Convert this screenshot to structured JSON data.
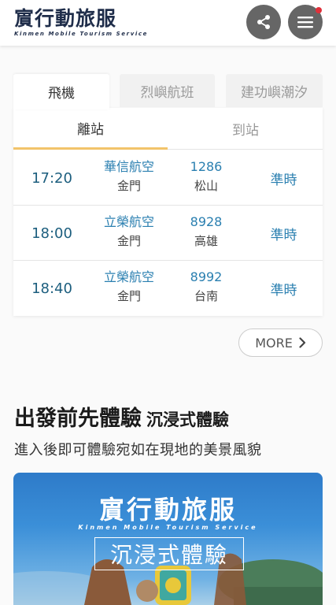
{
  "header": {
    "logo_text": "賔行動旅服",
    "logo_subtext": "Kinmen Mobile Tourism Service",
    "share_icon": "share-icon",
    "menu_icon": "hamburger-menu-icon"
  },
  "flight_tabs": [
    {
      "label": "飛機"
    },
    {
      "label": "烈嶼航班"
    },
    {
      "label": "建功嶼潮汐"
    }
  ],
  "direction_tabs": [
    {
      "label": "離站"
    },
    {
      "label": "到站"
    }
  ],
  "flights": [
    {
      "time": "17:20",
      "airline": "華信航空",
      "from": "金門",
      "flight_no": "1286",
      "to": "松山",
      "status": "準時"
    },
    {
      "time": "18:00",
      "airline": "立榮航空",
      "from": "金門",
      "flight_no": "8928",
      "to": "高雄",
      "status": "準時"
    },
    {
      "time": "18:40",
      "airline": "立榮航空",
      "from": "金門",
      "flight_no": "8992",
      "to": "台南",
      "status": "準時"
    }
  ],
  "more_button": {
    "label": "MORE",
    "icon": "chevron-right-icon"
  },
  "section": {
    "title": "出發前先體驗",
    "subtitle": "沉浸式體驗",
    "description": "進入後即可體驗宛如在現地的美景風貌"
  },
  "banner": {
    "logo_text": "賔行動旅服",
    "logo_subtext": "Kinmen Mobile Tourism Service",
    "box_text": "沉浸式體驗"
  },
  "colors": {
    "accent_underline": "#f2c46a",
    "link_blue": "#2a7fb0",
    "time_blue": "#1c5e7e",
    "notification_dot": "#e0303a"
  }
}
